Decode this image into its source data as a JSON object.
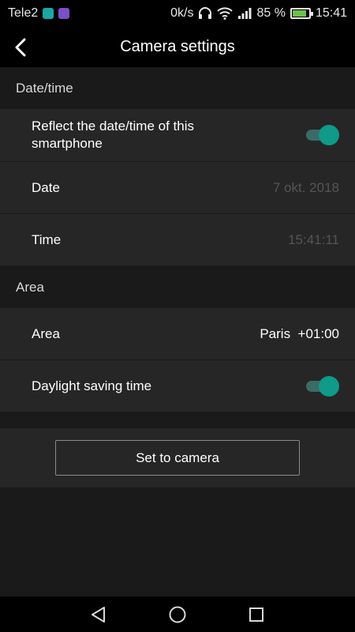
{
  "status_bar": {
    "carrier": "Tele2",
    "net_speed": "0k/s",
    "battery_percent": "85 %",
    "battery_level": 0.85,
    "time": "15:41"
  },
  "header": {
    "title": "Camera settings"
  },
  "sections": {
    "datetime": {
      "header": "Date/time",
      "reflect_label": "Reflect the date/time of this smartphone",
      "reflect_enabled": true,
      "date_label": "Date",
      "date_value": "7 okt. 2018",
      "time_label": "Time",
      "time_value": "15:41:11"
    },
    "area": {
      "header": "Area",
      "area_label": "Area",
      "area_value": "Paris  +01:00",
      "dst_label": "Daylight saving time",
      "dst_enabled": true
    }
  },
  "actions": {
    "set_to_camera": "Set to camera"
  },
  "colors": {
    "accent": "#0f9a8a",
    "background": "#1a1a1a",
    "row_background": "#262626"
  }
}
